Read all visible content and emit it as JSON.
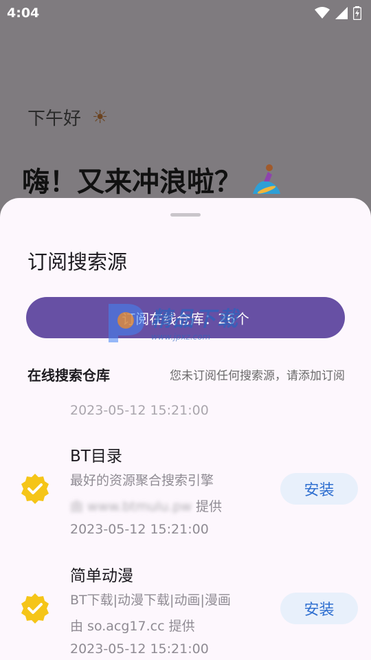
{
  "status_bar": {
    "time": "4:04"
  },
  "background": {
    "greeting": "下午好",
    "headline": "嗨！又来冲浪啦？"
  },
  "sheet": {
    "title": "订阅搜索源",
    "repo_button_label": "订阅在线仓库：26个",
    "section_title": "在线搜索仓库",
    "section_hint": "您未订阅任何搜索源，请添加订阅",
    "partial_date": "2023-05-12 15:21:00",
    "items": [
      {
        "name": "BT目录",
        "description": "最好的资源聚合搜索引擎",
        "provider_blurred": "由 www.btmulu.pw",
        "provider_suffix": "提供",
        "date": "2023-05-12 15:21:00",
        "install_label": "安装"
      },
      {
        "name": "简单动漫",
        "description": "BT下载|动漫下载|动画|漫画",
        "provider_blurred": "",
        "provider_suffix": "由 so.acg17.cc 提供",
        "date": "2023-05-12 15:21:00",
        "install_label": "安装"
      }
    ]
  },
  "watermark": {
    "text": "精品下载",
    "url": "www.jpxz.com"
  },
  "colors": {
    "primary": "#6750a4",
    "check": "#f5c518",
    "install_bg": "#e8f0fb",
    "install_text": "#2f6fd0"
  }
}
